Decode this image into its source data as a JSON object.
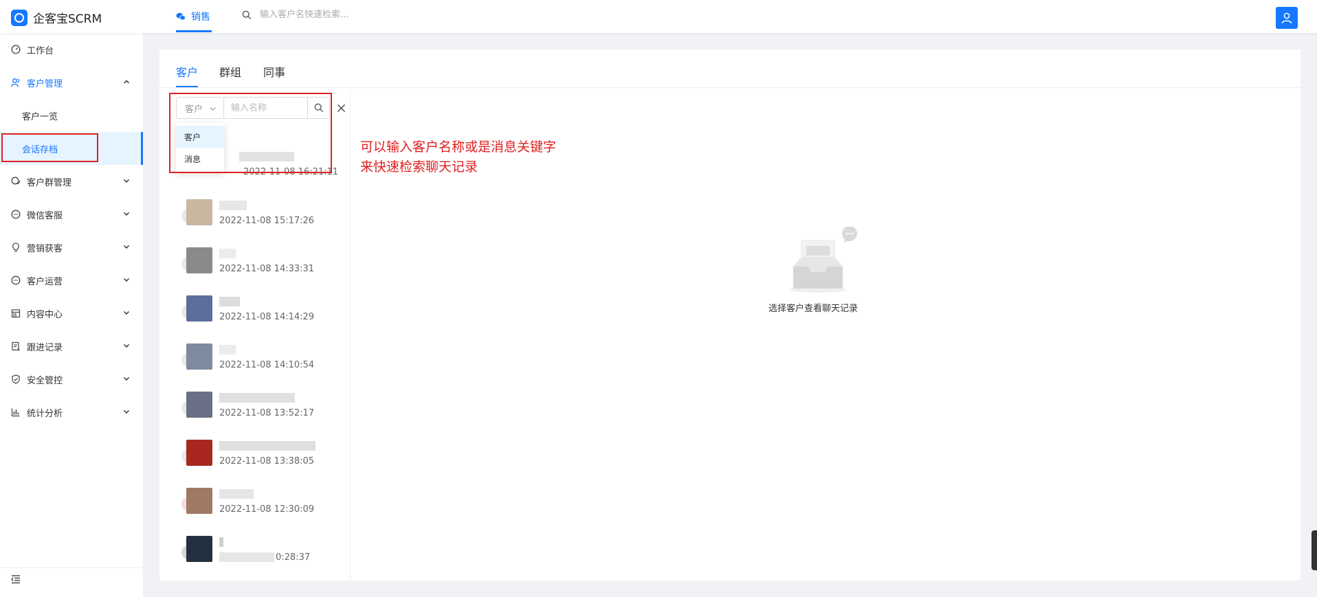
{
  "app": {
    "title": "企客宝SCRM",
    "top_tab": "销售",
    "search_placeholder": "输入客户名快速检索..."
  },
  "sidebar": {
    "items": [
      {
        "label": "工作台",
        "icon": "dashboard-icon"
      },
      {
        "label": "客户管理",
        "icon": "users-icon",
        "expanded": true,
        "children": [
          {
            "label": "客户一览"
          },
          {
            "label": "会话存档",
            "selected": true
          }
        ]
      },
      {
        "label": "客户群管理",
        "icon": "group-chat-icon"
      },
      {
        "label": "微信客服",
        "icon": "chat-dots-icon"
      },
      {
        "label": "营销获客",
        "icon": "lightbulb-icon"
      },
      {
        "label": "客户运营",
        "icon": "chat-dots-icon"
      },
      {
        "label": "内容中心",
        "icon": "store-icon"
      },
      {
        "label": "跟进记录",
        "icon": "record-icon"
      },
      {
        "label": "安全管控",
        "icon": "shield-icon"
      },
      {
        "label": "统计分析",
        "icon": "bar-chart-icon"
      }
    ]
  },
  "main": {
    "tabs": [
      {
        "label": "客户",
        "active": true
      },
      {
        "label": "群组"
      },
      {
        "label": "同事"
      }
    ],
    "search": {
      "type_selected": "客户",
      "name_placeholder": "输入名称",
      "type_options": [
        {
          "label": "客户",
          "selected": true
        },
        {
          "label": "消息"
        }
      ]
    },
    "conversations": [
      {
        "time": "2022-11-08 16:21:11",
        "avatar_color": "#b8a99a"
      },
      {
        "time": "2022-11-08 15:17:26",
        "avatar_color": "#c9b7a0"
      },
      {
        "time": "2022-11-08 14:33:31",
        "avatar_color": "#8a8a8a"
      },
      {
        "time": "2022-11-08 14:14:29",
        "avatar_color": "#5b6f9a"
      },
      {
        "time": "2022-11-08 14:10:54",
        "avatar_color": "#7d8aa0"
      },
      {
        "time": "2022-11-08 13:52:17",
        "avatar_color": "#6a6f85"
      },
      {
        "time": "2022-11-08 13:38:05",
        "avatar_color": "#a8281f"
      },
      {
        "time": "2022-11-08 12:30:09",
        "avatar_color": "#a07866"
      },
      {
        "time": "0:28:37",
        "avatar_color": "#22303f"
      }
    ],
    "empty_text": "选择客户查看聊天记录"
  },
  "annotation": {
    "line1": "可以输入客户名称或是消息关键字",
    "line2": "来快速检索聊天记录"
  },
  "colors": {
    "accent": "#1677ff",
    "annotation": "#e02020"
  }
}
